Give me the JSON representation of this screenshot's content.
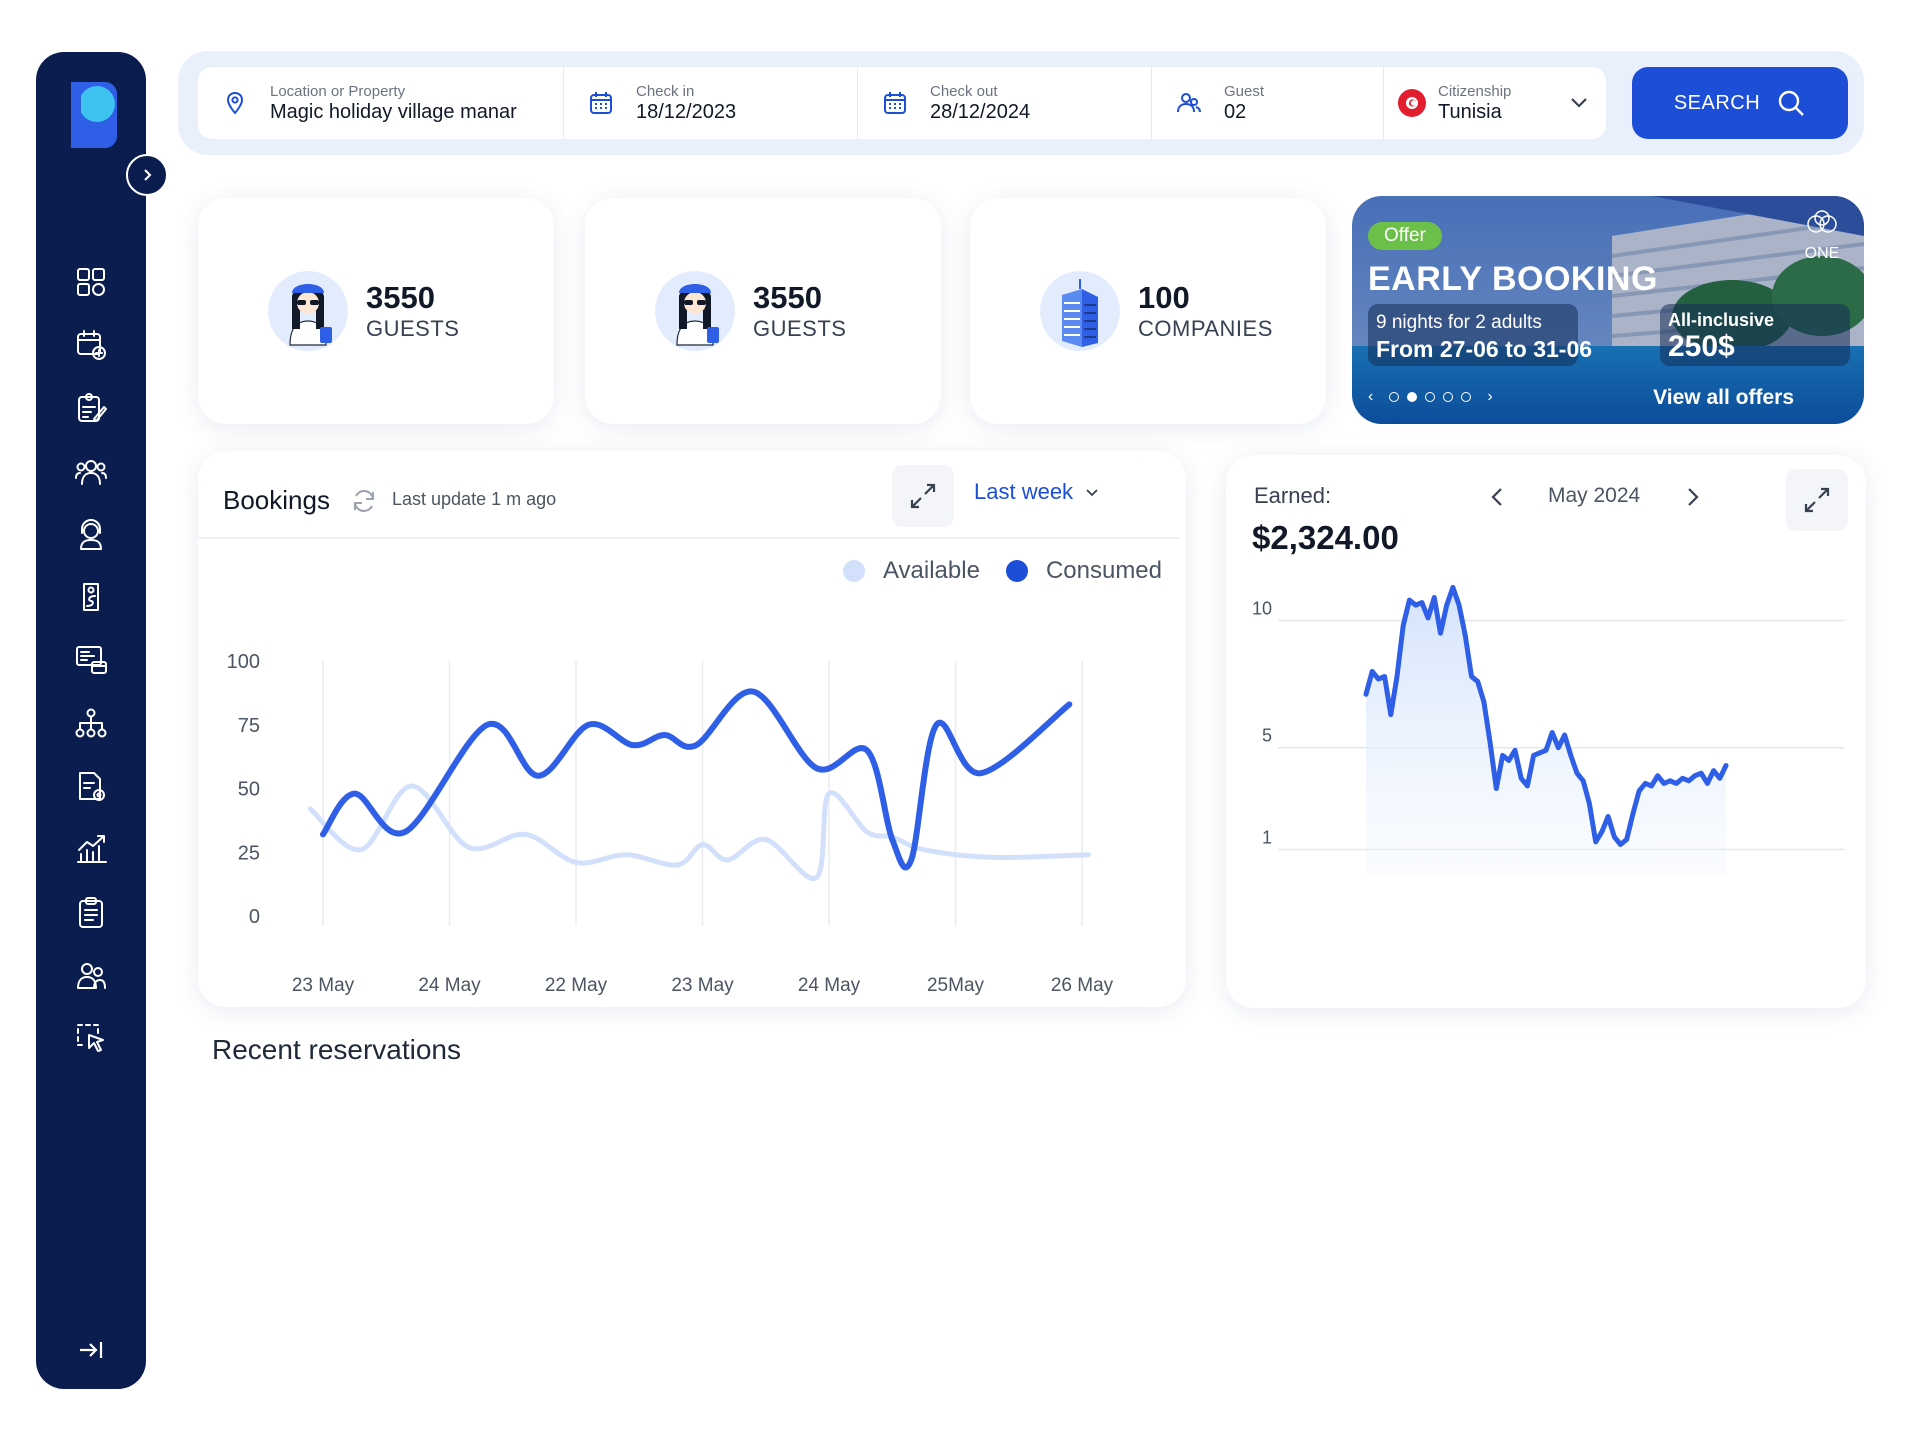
{
  "search": {
    "location_label": "Location or Property",
    "location_value": "Magic holiday village manar",
    "checkin_label": "Check in",
    "checkin_value": "18/12/2023",
    "checkout_label": "Check out",
    "checkout_value": "28/12/2024",
    "guest_label": "Guest",
    "guest_value": "02",
    "citizenship_label": "Citizenship",
    "citizenship_value": "Tunisia",
    "search_button": "SEARCH"
  },
  "stats": [
    {
      "value": "3550",
      "caption": "GUESTS",
      "icon": "guest-avatar-icon"
    },
    {
      "value": "3550",
      "caption": "GUESTS",
      "icon": "guest-avatar-icon"
    },
    {
      "value": "100",
      "caption": "COMPANIES",
      "icon": "building-icon"
    }
  ],
  "offer": {
    "badge": "Offer",
    "title": "EARLY BOOKING",
    "nights": "9 nights for 2 adults",
    "dates": "From 27-06 to 31-06",
    "inclusive": "All-inclusive",
    "price": "250$",
    "view_all": "View all offers",
    "brand": "ONE"
  },
  "bookings": {
    "title": "Bookings",
    "last_update": "Last update 1 m ago",
    "period": "Last week",
    "legend_available": "Available",
    "legend_consumed": "Consumed"
  },
  "earned": {
    "label": "Earned:",
    "amount": "$2,324.00",
    "month": "May 2024"
  },
  "recent_title": "Recent reservations",
  "sidebar_icons": [
    "dashboard-icon",
    "calendar-add-icon",
    "checklist-icon",
    "users-group-icon",
    "support-agent-icon",
    "key-tag-icon",
    "payment-screen-icon",
    "hierarchy-icon",
    "document-settings-icon",
    "analytics-icon",
    "clipboard-icon",
    "team-icon",
    "select-cursor-icon"
  ],
  "colors": {
    "sidebar": "#0b1d4e",
    "accent": "#1d4ed8",
    "consumed": "#2f5fe6",
    "available": "#d3e0fb",
    "offer_badge": "#6cc04a"
  },
  "chart_data": [
    {
      "type": "line",
      "title": "Bookings",
      "categories": [
        "23 May",
        "24 May",
        "22 May",
        "23 May",
        "24 May",
        "25May",
        "26 May"
      ],
      "ylim": [
        0,
        100
      ],
      "yticks": [
        0,
        25,
        50,
        75,
        100
      ],
      "series": [
        {
          "name": "Consumed",
          "points": [
            [
              0,
              32
            ],
            [
              0.25,
              48
            ],
            [
              0.65,
              33
            ],
            [
              1.3,
              75
            ],
            [
              1.7,
              55
            ],
            [
              2.1,
              75
            ],
            [
              2.45,
              67
            ],
            [
              2.7,
              71
            ],
            [
              2.95,
              67
            ],
            [
              3.4,
              88
            ],
            [
              3.9,
              58
            ],
            [
              4.3,
              65
            ],
            [
              4.5,
              30
            ],
            [
              4.65,
              22
            ],
            [
              4.85,
              75
            ],
            [
              5.2,
              56
            ],
            [
              5.9,
              83
            ]
          ]
        },
        {
          "name": "Available",
          "points": [
            [
              -0.1,
              42
            ],
            [
              0.3,
              26
            ],
            [
              0.7,
              51
            ],
            [
              1.15,
              27
            ],
            [
              1.6,
              32
            ],
            [
              2.0,
              21
            ],
            [
              2.4,
              24
            ],
            [
              2.8,
              20
            ],
            [
              3.0,
              28
            ],
            [
              3.2,
              22
            ],
            [
              3.5,
              30
            ],
            [
              3.9,
              15
            ],
            [
              4.0,
              48
            ],
            [
              4.3,
              33
            ],
            [
              4.5,
              31
            ],
            [
              4.75,
              26
            ],
            [
              5.3,
              23
            ],
            [
              6.05,
              24
            ]
          ]
        }
      ]
    },
    {
      "type": "area",
      "title": "Earned:",
      "ylim": [
        0,
        11
      ],
      "yticks": [
        1,
        5,
        10
      ],
      "x": [
        0,
        1,
        2,
        3,
        4,
        5,
        6,
        7,
        8,
        9,
        10,
        11,
        12,
        13,
        14,
        15,
        16,
        17,
        18,
        19,
        20,
        21,
        22,
        23,
        24,
        25,
        26,
        27,
        28,
        29,
        30,
        31,
        32,
        33,
        34,
        35,
        36,
        37,
        38,
        39,
        40,
        41,
        42,
        43,
        44,
        45,
        46,
        47,
        48,
        49,
        50,
        51,
        52,
        53,
        54,
        55,
        56,
        57,
        58
      ],
      "values": [
        7.1,
        8,
        7.7,
        7.8,
        6.3,
        7.8,
        9.8,
        10.8,
        10.6,
        10.7,
        10.1,
        10.9,
        9.5,
        10.6,
        11.3,
        10.6,
        9.4,
        7.8,
        7.6,
        6.8,
        5.2,
        3.4,
        4.7,
        4.5,
        4.9,
        3.8,
        3.5,
        4.7,
        4.8,
        4.9,
        5.6,
        5.0,
        5.5,
        4.7,
        4.0,
        3.7,
        2.8,
        1.3,
        1.7,
        2.3,
        1.5,
        1.2,
        1.4,
        2.4,
        3.3,
        3.6,
        3.5,
        3.9,
        3.6,
        3.7,
        3.6,
        3.8,
        3.7,
        3.9,
        4.0,
        3.6,
        4.1,
        3.8,
        4.3
      ]
    }
  ]
}
